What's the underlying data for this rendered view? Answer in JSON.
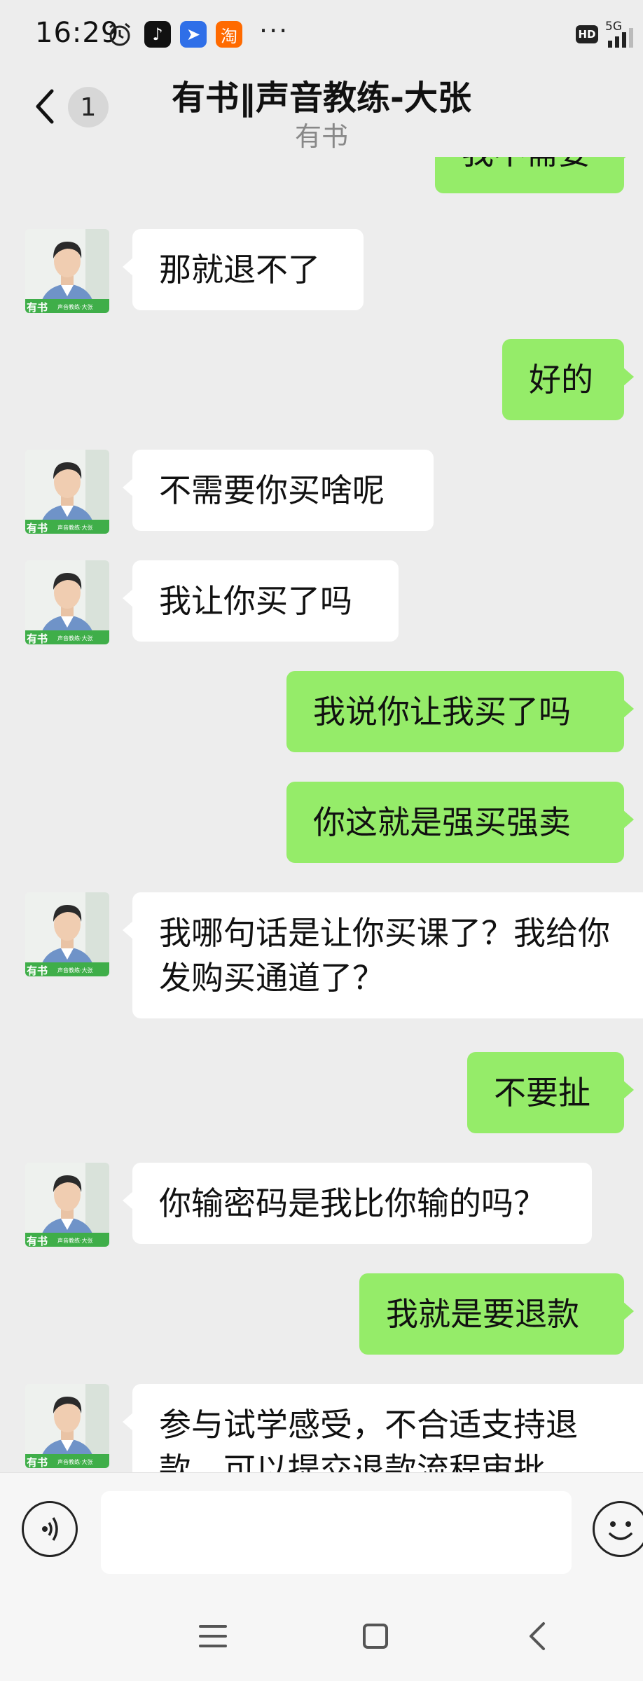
{
  "status": {
    "time": "16:29",
    "apps": [
      "alarm-icon",
      "douyin-icon",
      "feishu-icon",
      "taobao-icon"
    ],
    "more": "···",
    "hd": "HD",
    "network": "5G"
  },
  "header": {
    "unread_count": "1",
    "title": "有书‖声音教练-大张",
    "subtitle": "有书"
  },
  "messages": [
    {
      "side": "right",
      "text": "我不需要"
    },
    {
      "side": "left",
      "text": "那就退不了"
    },
    {
      "side": "right",
      "text": "好的"
    },
    {
      "side": "left",
      "text": "不需要你买啥呢"
    },
    {
      "side": "left",
      "text": "我让你买了吗"
    },
    {
      "side": "right",
      "text": "我说你让我买了吗"
    },
    {
      "side": "right",
      "text": "你这就是强买强卖"
    },
    {
      "side": "left",
      "text": "我哪句话是让你买课了？我给你发购买通道了？"
    },
    {
      "side": "right",
      "text": "不要扯"
    },
    {
      "side": "left",
      "text": "你输密码是我比你输的吗？"
    },
    {
      "side": "right",
      "text": "我就是要退款"
    },
    {
      "side": "left",
      "text": "参与试学感受，不合适支持退款，可以提交退款流程审批"
    }
  ],
  "avatar_caption": "声音教练·大张",
  "avatar_logo": "有书",
  "input": {
    "placeholder": ""
  },
  "colors": {
    "background": "#ededed",
    "self_bubble": "#95ec69",
    "other_bubble": "#ffffff"
  },
  "nav": [
    "menu-icon",
    "home-icon",
    "back-icon"
  ]
}
